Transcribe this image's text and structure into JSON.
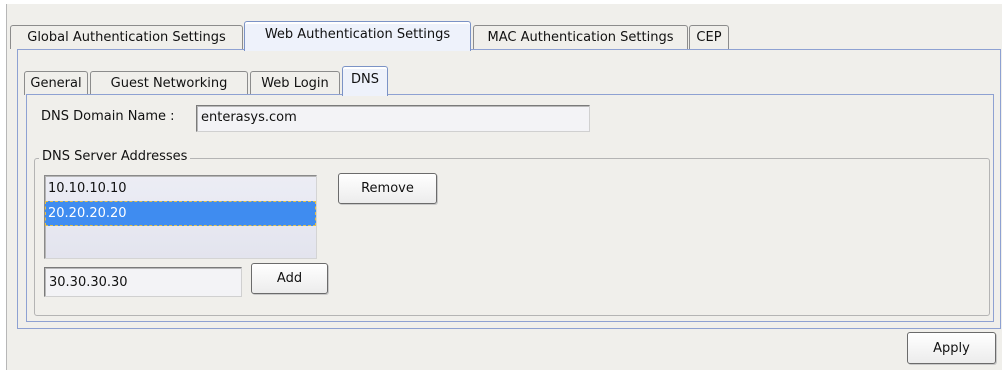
{
  "outer_tabs": [
    {
      "label": "Global Authentication Settings",
      "active": false
    },
    {
      "label": "Web Authentication Settings",
      "active": true
    },
    {
      "label": "MAC Authentication Settings",
      "active": false
    },
    {
      "label": "CEP",
      "active": false
    }
  ],
  "inner_tabs": [
    {
      "label": "General",
      "active": false
    },
    {
      "label": "Guest Networking",
      "active": false
    },
    {
      "label": "Web Login",
      "active": false
    },
    {
      "label": "DNS",
      "active": true
    }
  ],
  "dns": {
    "domain_label": "DNS Domain Name :",
    "domain_value": "enterasys.com",
    "server_group_title": "DNS Server Addresses",
    "servers": [
      {
        "address": "10.10.10.10",
        "selected": false
      },
      {
        "address": "20.20.20.20",
        "selected": true
      }
    ],
    "remove_label": "Remove",
    "new_address_value": "30.30.30.30",
    "add_label": "Add"
  },
  "footer": {
    "apply_label": "Apply"
  },
  "colors": {
    "panel_bg": "#f0efeb",
    "active_tab_border": "#7b93c6",
    "selection": "#3f8cf0"
  }
}
